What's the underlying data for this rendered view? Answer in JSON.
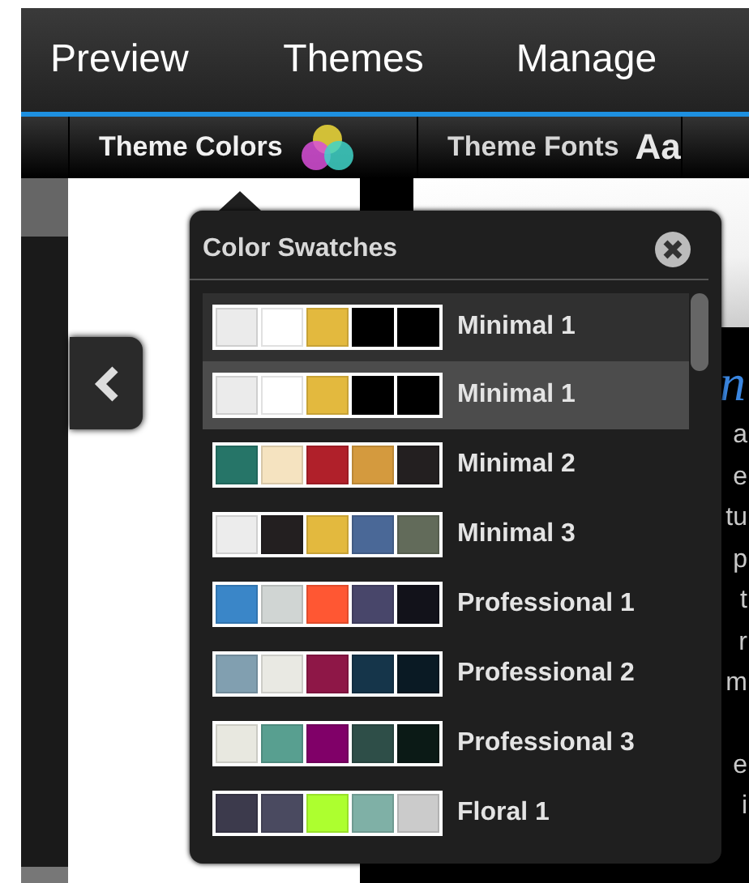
{
  "nav": [
    {
      "label": "Preview"
    },
    {
      "label": "Themes"
    },
    {
      "label": "Manage"
    }
  ],
  "tabs": [
    {
      "label": "Theme Colors",
      "kind": "colors",
      "selected": true
    },
    {
      "label": "Theme Fonts",
      "kind": "fonts",
      "icon_text": "Aa",
      "selected": false
    }
  ],
  "preview": {
    "heading": "n",
    "lines": [
      "a",
      "e",
      "tu",
      "p",
      "t",
      "r",
      "m",
      "e",
      "i"
    ]
  },
  "popover": {
    "title": "Color Swatches",
    "swatches": [
      {
        "name": "Minimal 1",
        "selected": false,
        "swatches": [
          {
            "color": "#ebebeb"
          },
          {
            "color": "#ffffff"
          },
          {
            "color": "#e3b93e"
          },
          {
            "color": "#000000"
          },
          {
            "color": "#000000"
          }
        ]
      },
      {
        "name": "Minimal 1",
        "selected": true,
        "swatches": [
          {
            "color": "#ebebeb"
          },
          {
            "color": "#ffffff"
          },
          {
            "color": "#e3b93e"
          },
          {
            "color": "#000000"
          },
          {
            "color": "#000000"
          }
        ]
      },
      {
        "name": "Minimal 2",
        "selected": false,
        "swatches": [
          {
            "color": "#267568"
          },
          {
            "color": "#f5e3c0"
          },
          {
            "color": "#b0202a"
          },
          {
            "color": "#d49a3e"
          },
          {
            "color": "#231f20"
          }
        ]
      },
      {
        "name": "Minimal 3",
        "selected": false,
        "swatches": [
          {
            "color": "#ececec"
          },
          {
            "color": "#231f20"
          },
          {
            "color": "#e3b93e"
          },
          {
            "color": "#4a6897"
          },
          {
            "color": "#626b5a"
          }
        ]
      },
      {
        "name": "Professional 1",
        "selected": false,
        "swatches": [
          {
            "color": "#3a86c8"
          },
          {
            "color": "#d0d5d3"
          },
          {
            "color": "#ff5733"
          },
          {
            "color": "#48466a"
          },
          {
            "color": "#12121a"
          }
        ]
      },
      {
        "name": "Professional 2",
        "selected": false,
        "swatches": [
          {
            "color": "#819fb0"
          },
          {
            "color": "#e9e9e3"
          },
          {
            "color": "#8e1747"
          },
          {
            "color": "#15354a"
          },
          {
            "color": "#0a1a24"
          }
        ]
      },
      {
        "name": "Professional 3",
        "selected": false,
        "swatches": [
          {
            "color": "#e8e8e0"
          },
          {
            "color": "#589f90"
          },
          {
            "color": "#800068"
          },
          {
            "color": "#2e4e48"
          },
          {
            "color": "#0b1a16"
          }
        ]
      },
      {
        "name": "Floral 1",
        "selected": false,
        "swatches": [
          {
            "color": "#3c3a4c"
          },
          {
            "color": "#4a4a60"
          },
          {
            "color": "#adff2f"
          },
          {
            "color": "#7fb0a6"
          },
          {
            "color": "#cbcbcb"
          }
        ]
      }
    ]
  }
}
